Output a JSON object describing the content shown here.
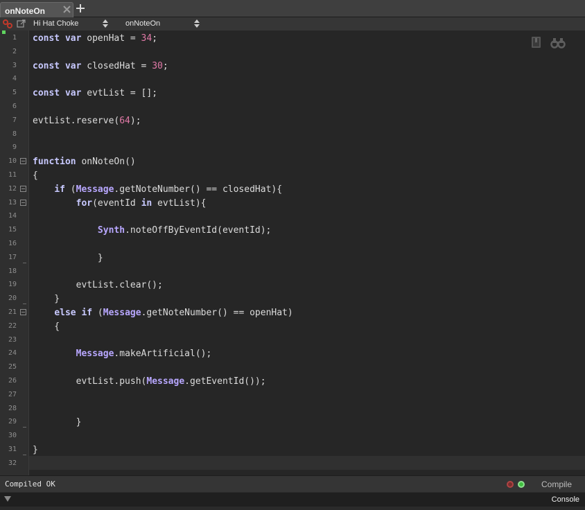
{
  "tab": {
    "label": "onNoteOn"
  },
  "toolbar": {
    "combo_left": "Hi Hat Choke",
    "combo_right": "onNoteOn"
  },
  "editor": {
    "line_numbers": [
      "1",
      "2",
      "3",
      "4",
      "5",
      "6",
      "7",
      "8",
      "9",
      "10",
      "11",
      "12",
      "13",
      "14",
      "15",
      "16",
      "17",
      "18",
      "19",
      "20",
      "21",
      "22",
      "23",
      "24",
      "25",
      "26",
      "27",
      "28",
      "29",
      "30",
      "31",
      "32"
    ],
    "lines": [
      [
        {
          "t": "const",
          "c": "kw"
        },
        {
          "t": " "
        },
        {
          "t": "var",
          "c": "kw"
        },
        {
          "t": " openHat = "
        },
        {
          "t": "34",
          "c": "num"
        },
        {
          "t": ";"
        }
      ],
      [],
      [
        {
          "t": "const",
          "c": "kw"
        },
        {
          "t": " "
        },
        {
          "t": "var",
          "c": "kw"
        },
        {
          "t": " closedHat = "
        },
        {
          "t": "30",
          "c": "num"
        },
        {
          "t": ";"
        }
      ],
      [],
      [
        {
          "t": "const",
          "c": "kw"
        },
        {
          "t": " "
        },
        {
          "t": "var",
          "c": "kw"
        },
        {
          "t": " evtList = [];"
        }
      ],
      [],
      [
        {
          "t": "evtList.reserve("
        },
        {
          "t": "64",
          "c": "num"
        },
        {
          "t": ");"
        }
      ],
      [],
      [],
      [
        {
          "t": "function",
          "c": "kw"
        },
        {
          "t": " onNoteOn()"
        }
      ],
      [
        {
          "t": "{"
        }
      ],
      [
        {
          "t": "    "
        },
        {
          "t": "if",
          "c": "kw"
        },
        {
          "t": " ("
        },
        {
          "t": "Message",
          "c": "obj"
        },
        {
          "t": ".getNoteNumber() == closedHat){"
        }
      ],
      [
        {
          "t": "        "
        },
        {
          "t": "for",
          "c": "kw"
        },
        {
          "t": "(eventId "
        },
        {
          "t": "in",
          "c": "kw"
        },
        {
          "t": " evtList){"
        }
      ],
      [],
      [
        {
          "t": "            "
        },
        {
          "t": "Synth",
          "c": "obj"
        },
        {
          "t": ".noteOffByEventId(eventId);"
        }
      ],
      [],
      [
        {
          "t": "            }"
        }
      ],
      [],
      [
        {
          "t": "        evtList.clear();"
        }
      ],
      [
        {
          "t": "    }"
        }
      ],
      [
        {
          "t": "    "
        },
        {
          "t": "else",
          "c": "kw"
        },
        {
          "t": " "
        },
        {
          "t": "if",
          "c": "kw"
        },
        {
          "t": " ("
        },
        {
          "t": "Message",
          "c": "obj"
        },
        {
          "t": ".getNoteNumber() == openHat)"
        }
      ],
      [
        {
          "t": "    {"
        }
      ],
      [],
      [
        {
          "t": "        "
        },
        {
          "t": "Message",
          "c": "obj"
        },
        {
          "t": ".makeArtificial();"
        }
      ],
      [],
      [
        {
          "t": "        evtList.push("
        },
        {
          "t": "Message",
          "c": "obj"
        },
        {
          "t": ".getEventId());"
        }
      ],
      [],
      [],
      [
        {
          "t": "        }"
        }
      ],
      [],
      [
        {
          "t": "}"
        }
      ],
      []
    ],
    "fold_markers": [
      10,
      12,
      13,
      21
    ],
    "current_line": 32
  },
  "status": {
    "message": "Compiled OK",
    "compile_label": "Compile",
    "led_error_color": "#7a2d2d",
    "led_ok_color": "#3fbf3f"
  },
  "console": {
    "label": "Console"
  },
  "icons": {
    "tab_close": "close-icon",
    "tab_add": "plus-icon",
    "toolbar_left": "link-icon",
    "toolbar_popout": "popout-icon",
    "editor_bookmark": "bookmark-icon",
    "editor_search": "binoculars-icon"
  }
}
